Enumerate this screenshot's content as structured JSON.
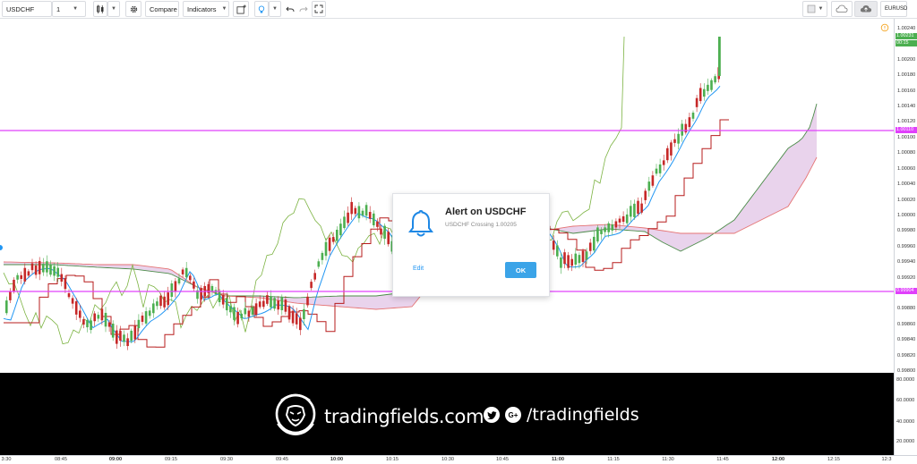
{
  "toolbar": {
    "symbol": "USDCHF",
    "interval": "1",
    "compare_label": "Compare",
    "indicators_label": "Indicators",
    "right_symbol": "EURUSD"
  },
  "alert": {
    "title": "Alert on USDCHF",
    "message": "USDCHF Crossing 1.00205",
    "edit_label": "Edit",
    "ok_label": "OK"
  },
  "price_axis": {
    "ticks": [
      "1.00240",
      "1.00200",
      "1.00180",
      "1.00160",
      "1.00140",
      "1.00120",
      "1.00100",
      "1.00080",
      "1.00060",
      "1.00040",
      "1.00020",
      "1.00000",
      "0.99980",
      "0.99960",
      "0.99940",
      "0.99920",
      "0.99880",
      "0.99860",
      "0.99840",
      "0.99820",
      "0.99800"
    ],
    "last_price": "1.00231",
    "countdown": "00:15",
    "upper_line_label": "1.00110",
    "lower_line_label": "0.99904"
  },
  "panel_axis": {
    "ticks": [
      "80.0000",
      "60.0000",
      "40.0000",
      "20.0000"
    ]
  },
  "time_axis": {
    "ticks": [
      {
        "label": "3:30",
        "bold": false
      },
      {
        "label": "08:45",
        "bold": false
      },
      {
        "label": "09:00",
        "bold": true
      },
      {
        "label": "09:15",
        "bold": false
      },
      {
        "label": "09:30",
        "bold": false
      },
      {
        "label": "09:45",
        "bold": false
      },
      {
        "label": "10:00",
        "bold": true
      },
      {
        "label": "10:15",
        "bold": false
      },
      {
        "label": "10:30",
        "bold": false
      },
      {
        "label": "10:45",
        "bold": false
      },
      {
        "label": "11:00",
        "bold": true
      },
      {
        "label": "11:15",
        "bold": false
      },
      {
        "label": "11:30",
        "bold": false
      },
      {
        "label": "11:45",
        "bold": false
      },
      {
        "label": "12:00",
        "bold": true
      },
      {
        "label": "12:15",
        "bold": false
      },
      {
        "label": "12:3",
        "bold": false
      }
    ]
  },
  "branding": {
    "site": "tradingfields.com",
    "handle": "/tradingfields",
    "social_google": "G+"
  },
  "colors": {
    "alert_line": "#e040fb",
    "up_candle": "#4caf50",
    "down_candle": "#c62828",
    "conversion_line": "#2196f3",
    "base_line": "#b71c1c",
    "lagging_span": "#7cb342",
    "cloud_fill": "#e1c4e6",
    "ok_button": "#3ba4e8"
  }
}
